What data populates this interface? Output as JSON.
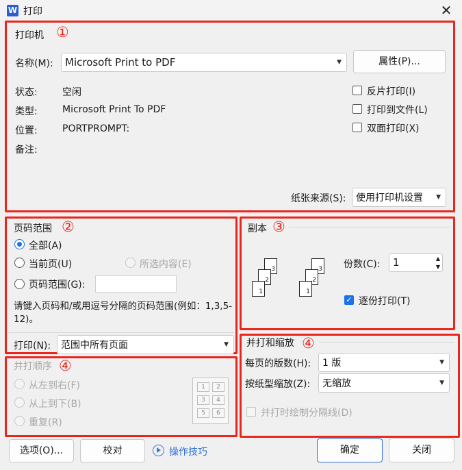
{
  "window": {
    "title": "打印",
    "app_icon_letter": "W"
  },
  "printer": {
    "group_title": "打印机",
    "marker": "①",
    "name_label": "名称(M):",
    "name_value": "Microsoft Print to PDF",
    "properties_button": "属性(P)...",
    "status_label": "状态:",
    "status_value": "空闲",
    "type_label": "类型:",
    "type_value": "Microsoft Print To PDF",
    "location_label": "位置:",
    "location_value": "PORTPROMPT:",
    "comment_label": "备注:",
    "reverse_print": "反片打印(I)",
    "print_to_file": "打印到文件(L)",
    "duplex": "双面打印(X)",
    "paper_source_label": "纸张来源(S):",
    "paper_source_value": "使用打印机设置"
  },
  "page_range": {
    "group_title": "页码范围",
    "marker": "②",
    "all": "全部(A)",
    "current": "当前页(U)",
    "selection": "所选内容(E)",
    "pages": "页码范围(G):",
    "pages_value": "",
    "hint": "请键入页码和/或用逗号分隔的页码范围(例如：1,3,5-12)。",
    "print_label": "打印(N):",
    "print_value": "范围中所有页面"
  },
  "copies": {
    "group_title": "副本",
    "marker": "③",
    "count_label": "份数(C):",
    "count_value": "1",
    "collate": "逐份打印(T)",
    "collate_checked": true,
    "page_numbers": [
      "1",
      "2",
      "3"
    ]
  },
  "order": {
    "group_title": "并打顺序",
    "marker": "④",
    "left_to_right": "从左到右(F)",
    "top_to_bottom": "从上到下(B)",
    "repeat": "重复(R)",
    "cells": [
      "1",
      "2",
      "3",
      "4",
      "5",
      "6"
    ]
  },
  "zoom": {
    "group_title": "并打和缩放",
    "marker": "④",
    "pages_per_sheet_label": "每页的版数(H):",
    "pages_per_sheet_value": "1 版",
    "scale_label": "按纸型缩放(Z):",
    "scale_value": "无缩放",
    "draw_borders": "并打时绘制分隔线(D)"
  },
  "footer": {
    "options_button": "选项(O)...",
    "proof_button": "校对",
    "tips_link": "操作技巧",
    "ok_button": "确定",
    "close_button": "关闭"
  },
  "colors": {
    "annotation_red": "#e8261d",
    "accent_blue": "#1a73e8"
  }
}
